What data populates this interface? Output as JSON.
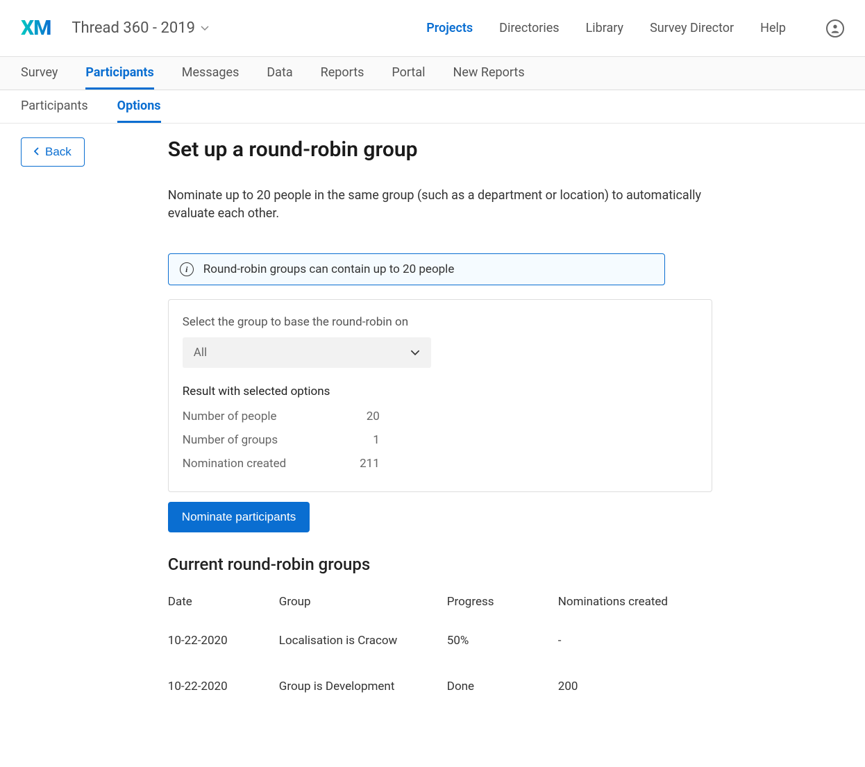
{
  "header": {
    "logo": "XM",
    "project_name": "Thread 360 - 2019",
    "nav": {
      "projects": "Projects",
      "directories": "Directories",
      "library": "Library",
      "survey_director": "Survey Director",
      "help": "Help"
    }
  },
  "tabs1": {
    "survey": "Survey",
    "participants": "Participants",
    "messages": "Messages",
    "data": "Data",
    "reports": "Reports",
    "portal": "Portal",
    "new_reports": "New Reports"
  },
  "tabs2": {
    "participants": "Participants",
    "options": "Options"
  },
  "back_label": "Back",
  "page": {
    "title": "Set up a round-robin group",
    "description": "Nominate up to 20 people in the same group (such as a department or location) to automatically evaluate each other.",
    "info_text": "Round-robin groups can contain up to 20 people",
    "select_label": "Select the group to base the round-robin on",
    "select_value": "All",
    "result_label": "Result with selected options",
    "results": {
      "people_label": "Number of people",
      "people_value": "20",
      "groups_label": "Number of groups",
      "groups_value": "1",
      "nominations_label": "Nomination created",
      "nominations_value": "211"
    },
    "nominate_btn": "Nominate participants",
    "current_title": "Current round-robin groups",
    "columns": {
      "date": "Date",
      "group": "Group",
      "progress": "Progress",
      "nominations": "Nominations created"
    },
    "rows": [
      {
        "date": "10-22-2020",
        "group": "Localisation is Cracow",
        "progress": "50%",
        "nominations": "-"
      },
      {
        "date": "10-22-2020",
        "group": "Group is Development",
        "progress": "Done",
        "nominations": "200"
      }
    ]
  }
}
